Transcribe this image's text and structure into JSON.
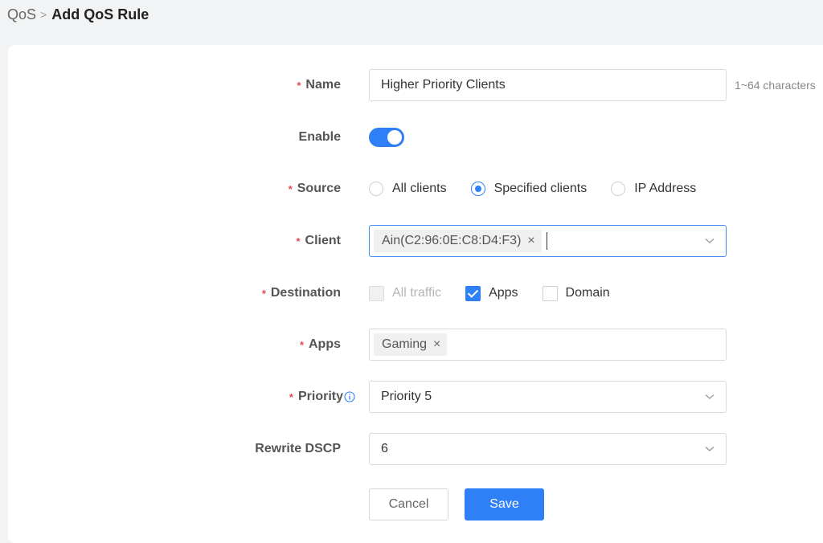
{
  "breadcrumb": {
    "parent": "QoS",
    "separator": ">",
    "current": "Add QoS Rule"
  },
  "form": {
    "name": {
      "label": "Name",
      "required": "*",
      "value": "Higher Priority Clients",
      "hint": "1~64 characters"
    },
    "enable": {
      "label": "Enable",
      "on": true
    },
    "source": {
      "label": "Source",
      "required": "*",
      "options": [
        "All clients",
        "Specified clients",
        "IP Address"
      ],
      "selected": "Specified clients"
    },
    "client": {
      "label": "Client",
      "required": "*",
      "tags": [
        "Ain(C2:96:0E:C8:D4:F3)"
      ],
      "remove_glyph": "×"
    },
    "destination": {
      "label": "Destination",
      "required": "*",
      "options": [
        "All traffic",
        "Apps",
        "Domain"
      ],
      "checked": [
        "Apps"
      ],
      "disabled": [
        "All traffic"
      ]
    },
    "apps": {
      "label": "Apps",
      "required": "*",
      "tags": [
        "Gaming"
      ],
      "remove_glyph": "×"
    },
    "priority": {
      "label": "Priority",
      "required": "*",
      "value": "Priority 5",
      "icon": "info-icon"
    },
    "rewrite_dscp": {
      "label": "Rewrite DSCP",
      "value": "6"
    }
  },
  "buttons": {
    "cancel": "Cancel",
    "save": "Save"
  },
  "colors": {
    "accent": "#2f7ff6",
    "required": "#e5484d"
  }
}
